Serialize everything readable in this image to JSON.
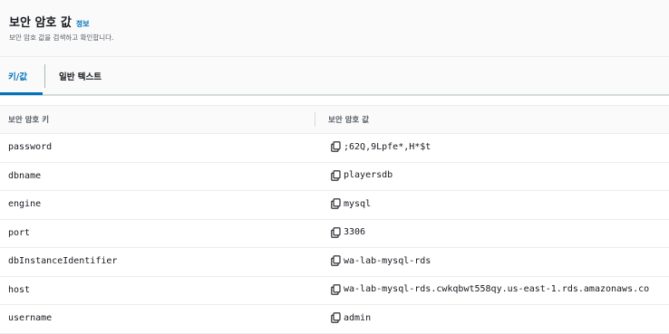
{
  "header": {
    "title": "보안 암호 값",
    "info_link": "정보",
    "subtitle": "보안 암호 값을 검색하고 확인합니다."
  },
  "tabs": [
    {
      "label": "키/값",
      "selected": true
    },
    {
      "label": "일반 텍스트",
      "selected": false
    }
  ],
  "table": {
    "columns": [
      "보안 암호 키",
      "보안 암호 값"
    ],
    "rows": [
      {
        "key": "password",
        "value": ";62Q,9Lpfe*,H*$t"
      },
      {
        "key": "dbname",
        "value": "playersdb"
      },
      {
        "key": "engine",
        "value": "mysql"
      },
      {
        "key": "port",
        "value": "3306"
      },
      {
        "key": "dbInstanceIdentifier",
        "value": "wa-lab-mysql-rds"
      },
      {
        "key": "host",
        "value": "wa-lab-mysql-rds.cwkqbwt558qy.us-east-1.rds.amazonaws.co"
      },
      {
        "key": "username",
        "value": "admin"
      }
    ]
  },
  "icons": {
    "copy": "copy-icon"
  },
  "colors": {
    "accent": "#0073bb",
    "text": "#16191f",
    "muted": "#545b64"
  }
}
